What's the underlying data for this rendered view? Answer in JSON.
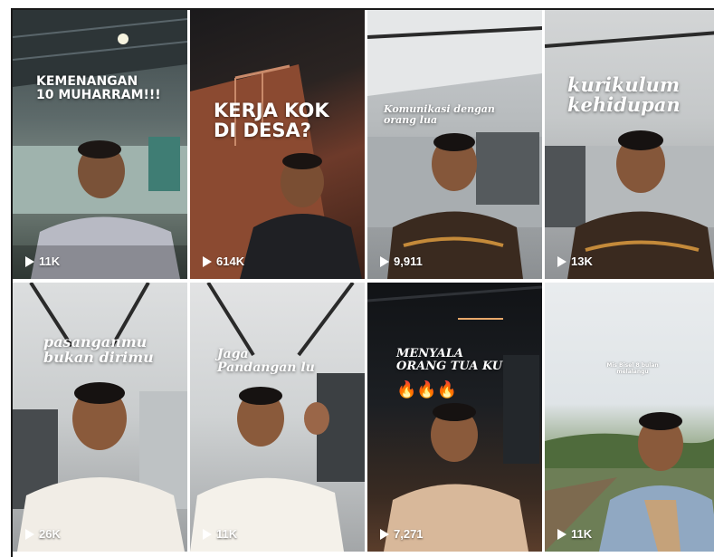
{
  "videos": [
    {
      "caption": "KEMENANGAN\n10 MUHARRAM!!!",
      "views": "11K"
    },
    {
      "caption": "KERJA KOK\nDI DESA?",
      "views": "614K"
    },
    {
      "caption": "Komunikasi dengan\norang lua",
      "views": "9,911"
    },
    {
      "caption": "kurikulum\nkehidupan",
      "views": "13K"
    },
    {
      "caption": "pasanganmu\nbukan dirimu",
      "views": "26K"
    },
    {
      "caption": "Jaga\nPandangan lu",
      "views": "11K"
    },
    {
      "caption": "MENYALA\nORANG TUA KU",
      "emoji": "🔥🔥🔥",
      "views": "7,271"
    },
    {
      "caption": "Mis Bisel 8 bulan\nmelalangu",
      "views": "11K"
    }
  ]
}
